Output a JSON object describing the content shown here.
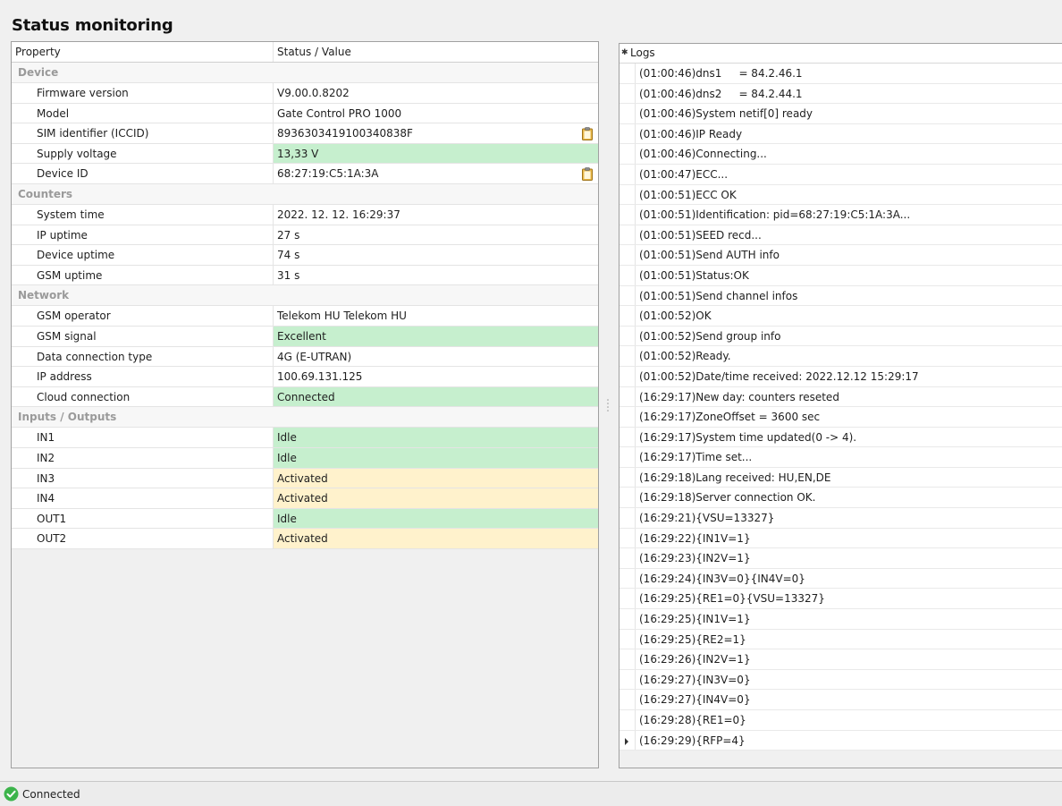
{
  "page_title": "Status monitoring",
  "grid": {
    "col_property": "Property",
    "col_value": "Status / Value",
    "categories": [
      {
        "name": "Device",
        "rows": [
          {
            "property": "Firmware version",
            "value": "V9.00.0.8202",
            "state": "none",
            "copy": false
          },
          {
            "property": "Model",
            "value": "Gate Control PRO 1000",
            "state": "none",
            "copy": false
          },
          {
            "property": "SIM identifier (ICCID)",
            "value": "8936303419100340838F",
            "state": "none",
            "copy": true
          },
          {
            "property": "Supply voltage",
            "value": "13,33 V",
            "state": "green",
            "copy": false
          },
          {
            "property": "Device ID",
            "value": "68:27:19:C5:1A:3A",
            "state": "none",
            "copy": true
          }
        ]
      },
      {
        "name": "Counters",
        "rows": [
          {
            "property": "System time",
            "value": "2022. 12. 12. 16:29:37",
            "state": "none",
            "copy": false
          },
          {
            "property": "IP uptime",
            "value": "27 s",
            "state": "none",
            "copy": false
          },
          {
            "property": "Device uptime",
            "value": "74 s",
            "state": "none",
            "copy": false
          },
          {
            "property": "GSM uptime",
            "value": "31 s",
            "state": "none",
            "copy": false
          }
        ]
      },
      {
        "name": "Network",
        "rows": [
          {
            "property": "GSM operator",
            "value": "Telekom HU Telekom HU",
            "state": "none",
            "copy": false
          },
          {
            "property": "GSM signal",
            "value": "Excellent",
            "state": "green",
            "copy": false
          },
          {
            "property": "Data connection type",
            "value": "4G (E-UTRAN)",
            "state": "none",
            "copy": false
          },
          {
            "property": "IP address",
            "value": "100.69.131.125",
            "state": "none",
            "copy": false
          },
          {
            "property": "Cloud connection",
            "value": "Connected",
            "state": "green",
            "copy": false
          }
        ]
      },
      {
        "name": "Inputs / Outputs",
        "rows": [
          {
            "property": "IN1",
            "value": "Idle",
            "state": "green",
            "copy": false
          },
          {
            "property": "IN2",
            "value": "Idle",
            "state": "green",
            "copy": false
          },
          {
            "property": "IN3",
            "value": "Activated",
            "state": "yellow",
            "copy": false
          },
          {
            "property": "IN4",
            "value": "Activated",
            "state": "yellow",
            "copy": false
          },
          {
            "property": "OUT1",
            "value": "Idle",
            "state": "green",
            "copy": false
          },
          {
            "property": "OUT2",
            "value": "Activated",
            "state": "yellow",
            "copy": false
          }
        ]
      }
    ]
  },
  "logs": {
    "header": "Logs",
    "header_icon": "asterisk-icon",
    "current_row_index": 33,
    "entries": [
      "(01:00:46)dns1     = 84.2.46.1",
      "(01:00:46)dns2     = 84.2.44.1",
      "(01:00:46)System netif[0] ready",
      "(01:00:46)IP Ready",
      "(01:00:46)Connecting...",
      "(01:00:47)ECC...",
      "(01:00:51)ECC OK",
      "(01:00:51)Identification: pid=68:27:19:C5:1A:3A...",
      "(01:00:51)SEED recd...",
      "(01:00:51)Send AUTH info",
      "(01:00:51)Status:OK",
      "(01:00:51)Send channel infos",
      "(01:00:52)OK",
      "(01:00:52)Send group info",
      "(01:00:52)Ready.",
      "(01:00:52)Date/time received: 2022.12.12 15:29:17",
      "(16:29:17)New day: counters reseted",
      "(16:29:17)ZoneOffset = 3600 sec",
      "(16:29:17)System time updated(0 -> 4).",
      "(16:29:17)Time set...",
      "(16:29:18)Lang received: HU,EN,DE",
      "(16:29:18)Server connection OK.",
      "(16:29:21){VSU=13327}",
      "(16:29:22){IN1V=1}",
      "(16:29:23){IN2V=1}",
      "(16:29:24){IN3V=0}{IN4V=0}",
      "(16:29:25){RE1=0}{VSU=13327}",
      "(16:29:25){IN1V=1}",
      "(16:29:25){RE2=1}",
      "(16:29:26){IN2V=1}",
      "(16:29:27){IN3V=0}",
      "(16:29:27){IN4V=0}",
      "(16:29:28){RE1=0}",
      "(16:29:29){RFP=4}"
    ]
  },
  "statusbar": {
    "icon": "check-circle-icon",
    "text": "Connected"
  },
  "colors": {
    "status_green": "#c6efce",
    "status_yellow": "#fff2cc",
    "category_text": "#9a9a9a",
    "status_icon": "#3cb44b"
  }
}
